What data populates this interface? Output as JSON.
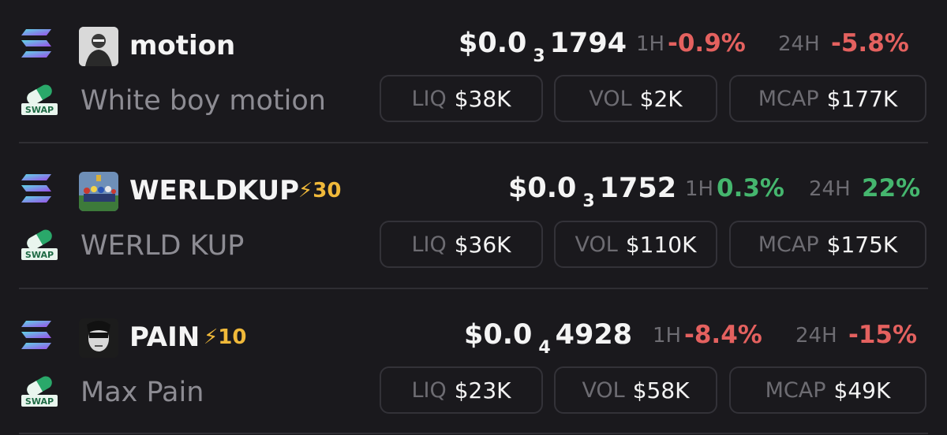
{
  "colors": {
    "background": "#1a191d",
    "negative": "#e4615f",
    "positive": "#45b66e",
    "boost": "#f0b93a",
    "muted": "#8d8c93"
  },
  "tokens": [
    {
      "symbol": "motion",
      "name": "White boy motion",
      "boost": "",
      "price_prefix": "$0.0",
      "price_zeros": "3",
      "price_digits": "1794",
      "change_1h_label": "1H",
      "change_1h": "-0.9%",
      "change_1h_dir": "neg",
      "change_24h_label": "24H",
      "change_24h": "-5.8%",
      "change_24h_dir": "neg",
      "liq_label": "LIQ",
      "liq": "$38K",
      "vol_label": "VOL",
      "vol": "$2K",
      "mcap_label": "MCAP",
      "mcap": "$177K",
      "chain_icon": "solana-icon",
      "dex_icon": "swap-icon",
      "avatar_icon": "avatar-motion"
    },
    {
      "symbol": "WERLDKUP",
      "name": "WERLD KUP",
      "boost": "⚡30",
      "price_prefix": "$0.0",
      "price_zeros": "3",
      "price_digits": "1752",
      "change_1h_label": "1H",
      "change_1h": "0.3%",
      "change_1h_dir": "pos",
      "change_24h_label": "24H",
      "change_24h": "22%",
      "change_24h_dir": "pos",
      "liq_label": "LIQ",
      "liq": "$36K",
      "vol_label": "VOL",
      "vol": "$110K",
      "mcap_label": "MCAP",
      "mcap": "$175K",
      "chain_icon": "solana-icon",
      "dex_icon": "swap-icon",
      "avatar_icon": "avatar-werldkup"
    },
    {
      "symbol": "PAIN",
      "name": "Max Pain",
      "boost": "⚡10",
      "price_prefix": "$0.0",
      "price_zeros": "4",
      "price_digits": "4928",
      "change_1h_label": "1H",
      "change_1h": "-8.4%",
      "change_1h_dir": "neg",
      "change_24h_label": "24H",
      "change_24h": "-15%",
      "change_24h_dir": "neg",
      "liq_label": "LIQ",
      "liq": "$23K",
      "vol_label": "VOL",
      "vol": "$58K",
      "mcap_label": "MCAP",
      "mcap": "$49K",
      "chain_icon": "solana-icon",
      "dex_icon": "swap-icon",
      "avatar_icon": "avatar-pain"
    }
  ],
  "swap_badge_text": "SWAP"
}
